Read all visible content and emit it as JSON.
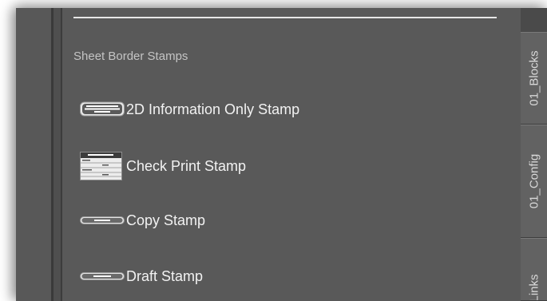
{
  "palette": {
    "section_title": "Sheet Border Stamps",
    "items": [
      {
        "label": "2D Information Only Stamp",
        "icon": "2d-information-only-stamp-icon",
        "icon_text": "DRAWING FOR 2D INFORMATION ONLY"
      },
      {
        "label": "Check Print Stamp",
        "icon": "check-print-stamp-icon",
        "icon_text": "CHECK PRINT"
      },
      {
        "label": "Copy Stamp",
        "icon": "copy-stamp-icon",
        "icon_text": "COPY"
      },
      {
        "label": "Draft Stamp",
        "icon": "draft-stamp-icon",
        "icon_text": "DRAFT"
      }
    ]
  },
  "tabs": [
    {
      "label": "01_Blocks"
    },
    {
      "label": "01_Config"
    },
    {
      "label": "Links"
    }
  ],
  "colors": {
    "panel_bg": "#595959",
    "tab_bg": "#626262",
    "text": "#f2f2f2",
    "section_text": "#c4c4c4"
  }
}
